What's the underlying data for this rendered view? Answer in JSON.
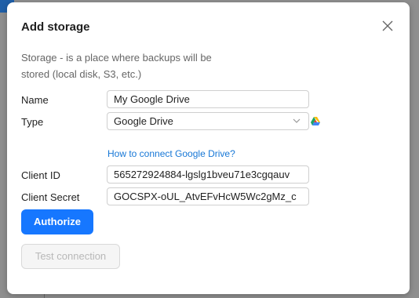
{
  "dialog": {
    "title": "Add storage",
    "description": "Storage - is a place where backups will be stored (local disk, S3, etc.)"
  },
  "form": {
    "name": {
      "label": "Name",
      "value": "My Google Drive"
    },
    "type": {
      "label": "Type",
      "value": "Google Drive",
      "icon": "google-drive-icon"
    },
    "help_link": "How to connect Google Drive?",
    "client_id": {
      "label": "Client ID",
      "value": "565272924884-lgslg1bveu71e3cgqauv"
    },
    "client_secret": {
      "label": "Client Secret",
      "value": "GOCSPX-oUL_AtvEFvHcW5Wc2gMz_c"
    }
  },
  "buttons": {
    "authorize": "Authorize",
    "test_connection": "Test connection"
  },
  "colors": {
    "primary": "#1677ff",
    "link": "#1677d6",
    "backdrop": "#8f8f8f"
  }
}
